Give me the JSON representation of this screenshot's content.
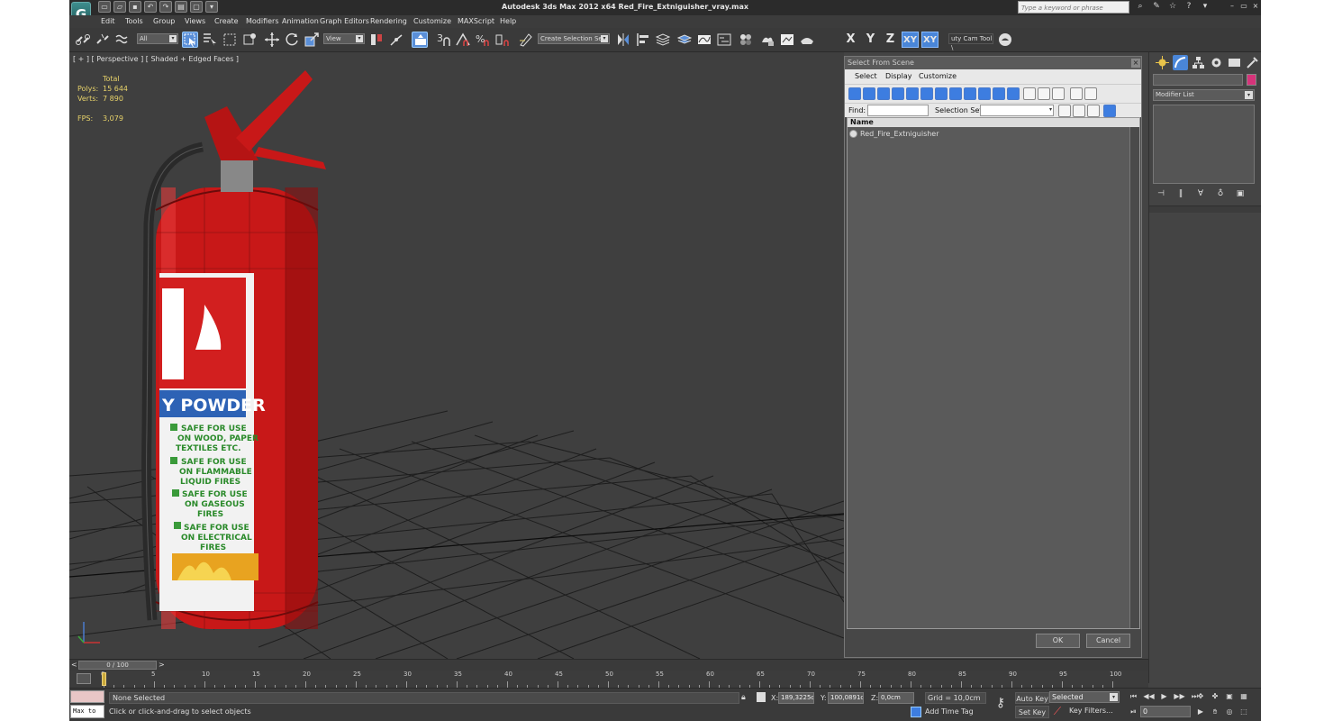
{
  "window": {
    "app_title": "Autodesk 3ds Max  2012 x64      Red_Fire_Extniguisher_vray.max",
    "search_placeholder": "Type a keyword or phrase",
    "help_icon": "?",
    "logo_glyph": "G"
  },
  "menu": [
    "Edit",
    "Tools",
    "Group",
    "Views",
    "Create",
    "Modifiers",
    "Animation",
    "Graph Editors",
    "Rendering",
    "Customize",
    "MAXScript",
    "Help"
  ],
  "toolbar": {
    "selection_filter": "All",
    "ref_coord": "View",
    "snap_angle_label": "3",
    "named_selection": "Create Selection Se",
    "axis_x": "X",
    "axis_y": "Y",
    "axis_z": "Z",
    "axis_xy": "XY",
    "axis_xy2": "XY",
    "cam_tool": "uty Cam Tool \\"
  },
  "viewport": {
    "label": "[ + ] [ Perspective ] [ Shaded + Edged Faces ]",
    "stats_header": "Total",
    "polys_label": "Polys:",
    "polys_value": "15 644",
    "verts_label": "Verts:",
    "verts_value": "7 890",
    "fps_label": "FPS:",
    "fps_value": "3,079",
    "sign_text_powder": "Y POWDER",
    "sign_lines": [
      "SAFE FOR USE",
      "ON WOOD, PAPER",
      "TEXTILES ETC.",
      "SAFE FOR USE",
      "ON FLAMMABLE",
      "LIQUID FIRES",
      "SAFE FOR USE",
      "ON GASEOUS",
      "FIRES",
      "SAFE FOR USE",
      "ON ELECTRICAL",
      "FIRES"
    ]
  },
  "dialog": {
    "title": "Select From Scene",
    "close": "×",
    "menu": [
      "Select",
      "Display",
      "Customize"
    ],
    "find_label": "Find:",
    "find_value": "",
    "selection_set_label": "Selection Set:",
    "list_header": "Name",
    "items": [
      "Red_Fire_Extniguisher"
    ],
    "ok": "OK",
    "cancel": "Cancel"
  },
  "command_panel": {
    "modifier_list": "Modifier List",
    "swatch_color": "#d6337a"
  },
  "timeline": {
    "slider_text": "0 / 100",
    "prev": "<",
    "next": ">",
    "frames": [
      "0",
      "5",
      "10",
      "15",
      "20",
      "25",
      "30",
      "35",
      "40",
      "45",
      "50",
      "55",
      "60",
      "65",
      "70",
      "75",
      "80",
      "85",
      "90",
      "95",
      "100"
    ]
  },
  "status": {
    "selection": "None Selected",
    "prompt": "Click or click-and-drag to select objects",
    "listener_text": "Max to",
    "x_label": "X:",
    "x_value": "189,3225c",
    "y_label": "Y:",
    "y_value": "100,0891c",
    "z_label": "Z:",
    "z_value": "0,0cm",
    "grid": "Grid = 10,0cm",
    "add_time_tag": "Add Time Tag",
    "auto_key": "Auto Key",
    "set_key": "Set Key",
    "key_mode": "Selected",
    "key_filters": "Key Filters...",
    "current_frame": "0"
  }
}
